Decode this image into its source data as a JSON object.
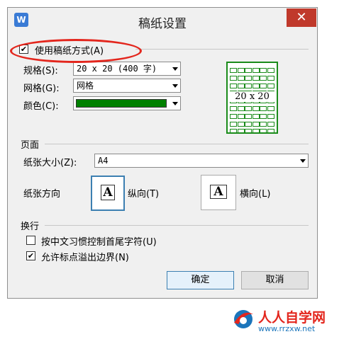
{
  "window": {
    "title": "稿纸设置",
    "app_icon": "W",
    "close_glyph": "✕"
  },
  "use_grid_paper": {
    "label": "使用稿纸方式(A)",
    "checked": true
  },
  "spec": {
    "label": "规格(S):",
    "value": "20 x 20 (400 字)"
  },
  "grid": {
    "label": "网格(G):",
    "value": "网格"
  },
  "color": {
    "label": "颜色(C):",
    "value_color": "#008000"
  },
  "preview": {
    "text": "20 x 20",
    "color": "#1a8b1a"
  },
  "page": {
    "section_label": "页面",
    "paper_size_label": "纸张大小(Z):",
    "paper_size_value": "A4",
    "orientation_label": "纸张方向",
    "portrait_label": "纵向(T)",
    "landscape_label": "横向(L)",
    "page_glyph": "A",
    "selected": "portrait"
  },
  "line_break": {
    "section_label": "换行",
    "option1": {
      "label": "按中文习惯控制首尾字符(U)",
      "checked": false
    },
    "option2": {
      "label": "允许标点溢出边界(N)",
      "checked": true
    }
  },
  "buttons": {
    "ok": "确定",
    "cancel": "取消"
  },
  "watermark": {
    "brand": "人人自学网",
    "url": "www.rrzxw.net",
    "accent": "#e3261d"
  },
  "colors": {
    "highlight": "#e3261d",
    "accent_blue": "#3c7fb1"
  },
  "check_glyph": "✔",
  "caret_glyph": "▾"
}
